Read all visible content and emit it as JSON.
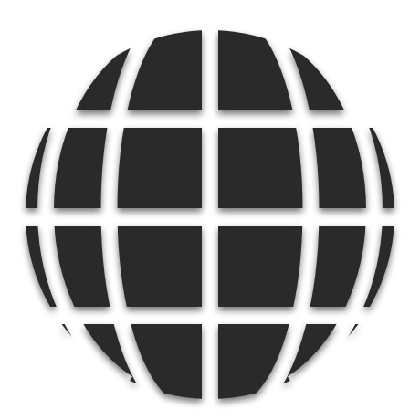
{
  "icon": {
    "name": "globe-icon",
    "fill_color": "#2b2b2b",
    "background_color": "#ffffff",
    "shadow_color": "#000000"
  }
}
